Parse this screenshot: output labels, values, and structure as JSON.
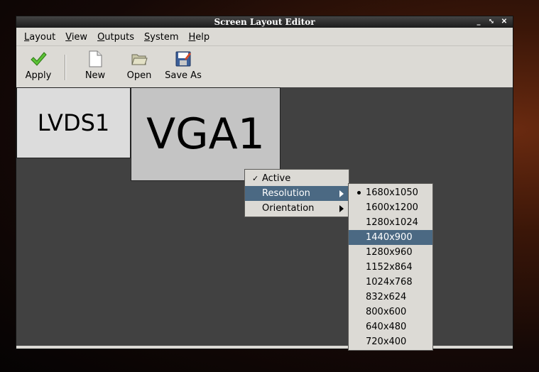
{
  "window": {
    "title": "Screen Layout Editor",
    "controls": [
      "_",
      "⤡",
      "✕"
    ]
  },
  "menubar": {
    "items": [
      "Layout",
      "View",
      "Outputs",
      "System",
      "Help"
    ]
  },
  "toolbar": {
    "apply": "Apply",
    "new": "New",
    "open": "Open",
    "save_as": "Save As"
  },
  "monitors": {
    "lvds": "LVDS1",
    "vga": "VGA1"
  },
  "context_menu": {
    "items": [
      {
        "label": "Active",
        "checked": true
      },
      {
        "label": "Resolution",
        "highlighted": true,
        "submenu": true
      },
      {
        "label": "Orientation",
        "submenu": true
      }
    ]
  },
  "resolution_menu": {
    "selected": "1680x1050",
    "hovered": "1440x900",
    "items": [
      "1680x1050",
      "1600x1200",
      "1280x1024",
      "1440x900",
      "1280x960",
      "1152x864",
      "1024x768",
      "832x624",
      "800x600",
      "640x480",
      "720x400"
    ]
  },
  "colors": {
    "highlight": "#4b6983",
    "canvas": "#414141",
    "apply_icon": "#5bc236"
  }
}
